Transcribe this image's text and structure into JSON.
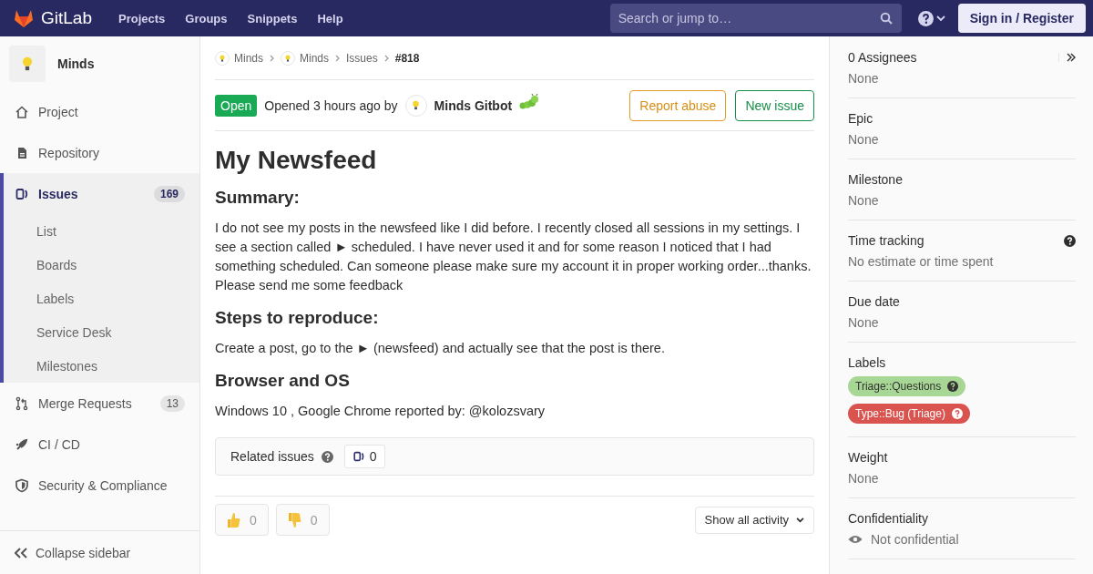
{
  "topbar": {
    "brand": "GitLab",
    "nav": [
      "Projects",
      "Groups",
      "Snippets",
      "Help"
    ],
    "search": {
      "placeholder": "Search or jump to…"
    },
    "sign_in": "Sign in / Register"
  },
  "sidebar": {
    "project": "Minds",
    "items": [
      {
        "label": "Project",
        "selected": false
      },
      {
        "label": "Repository",
        "selected": false
      },
      {
        "label": "Issues",
        "selected": true,
        "count": "169",
        "children": [
          "List",
          "Boards",
          "Labels",
          "Service Desk",
          "Milestones"
        ]
      },
      {
        "label": "Merge Requests",
        "selected": false,
        "count": "13"
      },
      {
        "label": "CI / CD",
        "selected": false
      },
      {
        "label": "Security & Compliance",
        "selected": false
      }
    ],
    "collapse": "Collapse sidebar"
  },
  "breadcrumb": [
    "Minds",
    "Minds",
    "Issues",
    "#818"
  ],
  "issue": {
    "status": "Open",
    "opened": "Opened 3 hours ago by",
    "author": "Minds Gitbot",
    "report": "Report abuse",
    "new_issue": "New issue",
    "title": "My Newsfeed",
    "sections": [
      {
        "heading": "Summary:",
        "text": "I do not see my posts in the newsfeed like I did before. I recently closed all sessions in my settings. I see a section called ► scheduled. I have never used it and for some reason I noticed that I had something scheduled. Can someone please make sure my account it in proper working order...thanks. Please send me some feedback"
      },
      {
        "heading": "Steps to reproduce:",
        "text": "Create a post, go to the ► (newsfeed) and actually see that the post is there."
      },
      {
        "heading": "Browser and OS",
        "text": "Windows 10 , Google Chrome reported by: @kolozsvary"
      }
    ],
    "related": {
      "label": "Related issues",
      "count": "0"
    },
    "upvotes": "0",
    "downvotes": "0",
    "activity": "Show all activity"
  },
  "right_sidebar": [
    {
      "label": "0 Assignees",
      "value": "None"
    },
    {
      "label": "Epic",
      "value": "None"
    },
    {
      "label": "Milestone",
      "value": "None"
    },
    {
      "label": "Time tracking",
      "value": "No estimate or time spent"
    },
    {
      "label": "Due date",
      "value": "None"
    },
    {
      "label": "Labels",
      "labels": [
        {
          "text": "Triage::Questions",
          "color": "#a8d695"
        },
        {
          "text": "Type::Bug (Triage)",
          "color": "#d9534f"
        }
      ]
    },
    {
      "label": "Weight",
      "value": "None"
    },
    {
      "label": "Confidentiality",
      "value": "Not confidential"
    }
  ]
}
